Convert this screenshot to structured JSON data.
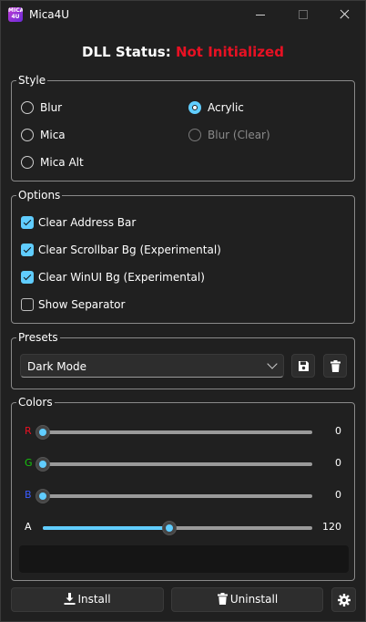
{
  "window": {
    "title": "Mica4U",
    "icon_text": "MICA 4U"
  },
  "status": {
    "label": "DLL Status:",
    "value": "Not Initialized",
    "value_color": "#e81123"
  },
  "style_group": {
    "title": "Style",
    "options": [
      {
        "label": "Blur",
        "checked": false,
        "enabled": true
      },
      {
        "label": "Acrylic",
        "checked": true,
        "enabled": true
      },
      {
        "label": "Mica",
        "checked": false,
        "enabled": true
      },
      {
        "label": "Blur (Clear)",
        "checked": false,
        "enabled": false
      },
      {
        "label": "Mica Alt",
        "checked": false,
        "enabled": true
      }
    ]
  },
  "options_group": {
    "title": "Options",
    "items": [
      {
        "label": "Clear Address Bar",
        "checked": true
      },
      {
        "label": "Clear Scrollbar Bg (Experimental)",
        "checked": true
      },
      {
        "label": "Clear WinUI Bg (Experimental)",
        "checked": true
      },
      {
        "label": "Show Separator",
        "checked": false
      }
    ]
  },
  "presets_group": {
    "title": "Presets",
    "selected": "Dark Mode",
    "save_icon": "save-icon",
    "delete_icon": "trash-icon"
  },
  "colors_group": {
    "title": "Colors",
    "channels": [
      {
        "label": "R",
        "value": 0,
        "max": 255,
        "color": "#e81123"
      },
      {
        "label": "G",
        "value": 0,
        "max": 255,
        "color": "#16c60c"
      },
      {
        "label": "B",
        "value": 0,
        "max": 255,
        "color": "#3a5bff"
      },
      {
        "label": "A",
        "value": 120,
        "max": 255,
        "color": "#ffffff"
      }
    ],
    "preview_color": "#151515"
  },
  "buttons": {
    "install": "Install",
    "uninstall": "Uninstall",
    "settings_icon": "gear-icon"
  },
  "accent": "#60cdff"
}
